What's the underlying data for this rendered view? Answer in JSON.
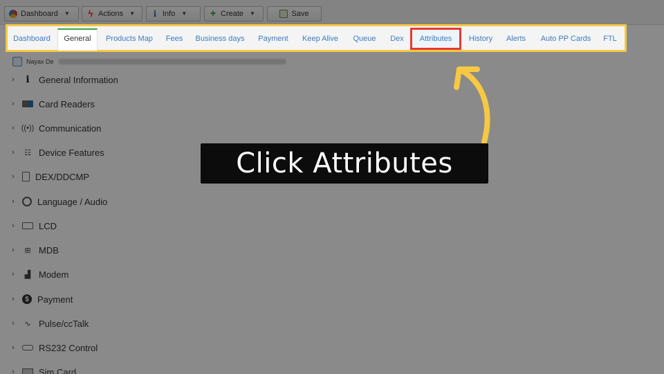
{
  "toolbar": {
    "dashboard_label": "Dashboard",
    "actions_label": "Actions",
    "info_label": "Info",
    "create_label": "Create",
    "save_label": "Save"
  },
  "tabs": [
    {
      "label": "Dashboard",
      "state": "normal"
    },
    {
      "label": "General",
      "state": "active"
    },
    {
      "label": "Products Map",
      "state": "normal"
    },
    {
      "label": "Fees",
      "state": "normal"
    },
    {
      "label": "Business days",
      "state": "normal"
    },
    {
      "label": "Payment",
      "state": "normal"
    },
    {
      "label": "Keep Alive",
      "state": "normal"
    },
    {
      "label": "Queue",
      "state": "normal"
    },
    {
      "label": "Dex",
      "state": "normal"
    },
    {
      "label": "Attributes",
      "state": "highlighted"
    },
    {
      "label": "History",
      "state": "normal"
    },
    {
      "label": "Alerts",
      "state": "normal"
    },
    {
      "label": "Auto PP Cards",
      "state": "normal"
    },
    {
      "label": "FTL",
      "state": "normal"
    }
  ],
  "breadcrumb": {
    "text": "Nayax De"
  },
  "tree": [
    {
      "label": "General Information",
      "icon": "info-icon"
    },
    {
      "label": "Card Readers",
      "icon": "card-reader-icon"
    },
    {
      "label": "Communication",
      "icon": "antenna-icon"
    },
    {
      "label": "Device Features",
      "icon": "device-features-icon"
    },
    {
      "label": "DEX/DDCMP",
      "icon": "dex-icon"
    },
    {
      "label": "Language / Audio",
      "icon": "globe-icon"
    },
    {
      "label": "LCD",
      "icon": "lcd-icon"
    },
    {
      "label": "MDB",
      "icon": "mdb-icon"
    },
    {
      "label": "Modem",
      "icon": "modem-icon"
    },
    {
      "label": "Payment",
      "icon": "payment-icon"
    },
    {
      "label": "Pulse/ccTalk",
      "icon": "pulse-icon"
    },
    {
      "label": "RS232 Control",
      "icon": "rs232-icon"
    },
    {
      "label": "Sim Card",
      "icon": "sim-card-icon"
    }
  ],
  "callout": {
    "text": "Click Attributes",
    "arrow_color": "#f6c844",
    "highlight_color": "#e23b33",
    "frame_color": "#f6c844"
  }
}
